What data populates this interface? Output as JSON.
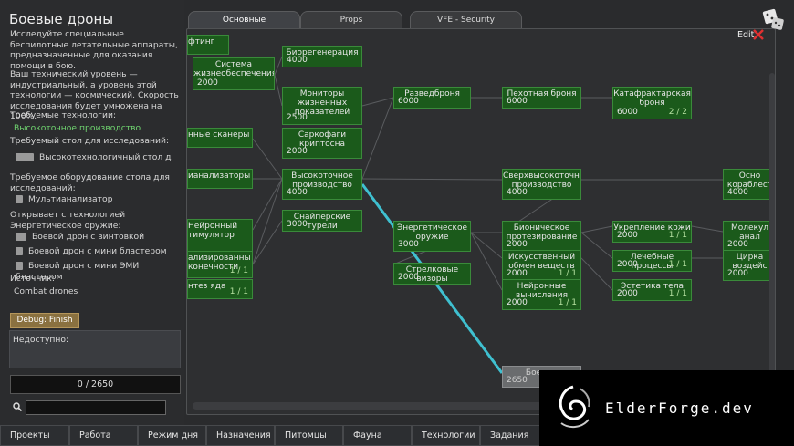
{
  "left_panel": {
    "title": "Боевые дроны",
    "description": "Исследуйте специальные беспилотные летательные аппараты, предназначенные для оказания помощи в бою.",
    "tech_level": "Ваш технический уровень — индустриальный, а уровень этой технологии — космический. Скорость исследования будет умножена на 100%.",
    "required_techs_label": "Требуемые технологии:",
    "required_tech": "Высокоточное производство",
    "required_bench_label": "Требуемый стол для исследований:",
    "required_bench": "Высокотехнологичный стол для исс",
    "required_equipment_label": "Требуемое оборудование стола для исследований:",
    "required_equipment": "Мультианализатор",
    "unlocks_label": "Открывает с технологией Энергетическое оружие:",
    "unlocks": [
      "Боевой дрон с винтовкой",
      "Боевой дрон с мини бластером",
      "Боевой дрон с мини ЭМИ бластером"
    ],
    "source_label": "Источник:",
    "source": "Combat drones",
    "debug_button": "Debug: Finish now",
    "unavailable_label": "Недоступно:",
    "progress": "0 / 2650"
  },
  "tabs": [
    {
      "label": "Основные"
    },
    {
      "label": "Props"
    },
    {
      "label": "VFE - Security"
    }
  ],
  "edit_label": "Edit",
  "nodes": [
    {
      "label": "фтинг",
      "cost": "",
      "count": ""
    },
    {
      "label": "Система жизнеобеспечения",
      "cost": "2000",
      "count": ""
    },
    {
      "label": "Биорегенерация",
      "cost": "4000",
      "count": ""
    },
    {
      "label": "Мониторы жизненных показателей",
      "cost": "2500",
      "count": ""
    },
    {
      "label": "Разведброня",
      "cost": "6000",
      "count": ""
    },
    {
      "label": "Пехотная броня",
      "cost": "6000",
      "count": ""
    },
    {
      "label": "Катафрактарская броня",
      "cost": "6000",
      "count": "2 / 2"
    },
    {
      "label": "нные сканеры",
      "cost": "",
      "count": ""
    },
    {
      "label": "Саркофаги криптосна",
      "cost": "2000",
      "count": ""
    },
    {
      "label": "ианализаторы",
      "cost": "",
      "count": ""
    },
    {
      "label": "Высокоточное производство",
      "cost": "4000",
      "count": ""
    },
    {
      "label": "Сверхвысокоточное производство",
      "cost": "4000",
      "count": ""
    },
    {
      "label": "Осно кораблест",
      "cost": "4000",
      "count": ""
    },
    {
      "label": "Снайперские турели",
      "cost": "3000",
      "count": ""
    },
    {
      "label": "Нейронный тимулятор",
      "cost": "",
      "count": ""
    },
    {
      "label": "Энергетическое оружие",
      "cost": "3000",
      "count": ""
    },
    {
      "label": "Бионическое протезирование",
      "cost": "2000",
      "count": ""
    },
    {
      "label": "Укрепление кожи",
      "cost": "2000",
      "count": "1 / 1"
    },
    {
      "label": "Молекул анал",
      "cost": "2000",
      "count": ""
    },
    {
      "label": "ализированны конечности",
      "cost": "",
      "count": "1 / 1"
    },
    {
      "label": "Искусственный обмен веществ",
      "cost": "2000",
      "count": "1 / 1"
    },
    {
      "label": "Лечебные процессы",
      "cost": "2000",
      "count": "1 / 1"
    },
    {
      "label": "Цирка воздейс",
      "cost": "2000",
      "count": ""
    },
    {
      "label": "Стрелковые визоры",
      "cost": "2000",
      "count": ""
    },
    {
      "label": "нтез яда",
      "cost": "",
      "count": "1 / 1"
    },
    {
      "label": "Нейронные вычисления",
      "cost": "2000",
      "count": "1 / 1"
    },
    {
      "label": "Эстетика тела",
      "cost": "2000",
      "count": "1 / 1"
    },
    {
      "label": "Боевые",
      "cost": "2650",
      "count": ""
    }
  ],
  "bottom_tabs": [
    "Проекты",
    "Работа",
    "Режим дня",
    "Назначения",
    "Питомцы",
    "Фауна",
    "Технологии",
    "Задания"
  ],
  "watermark": "ElderForge.dev",
  "colors": {
    "node_green": "#1b5a1b",
    "node_border": "#3a8a3a",
    "highlight_line": "#3fc0d0",
    "required_tech": "#6fd36f"
  }
}
